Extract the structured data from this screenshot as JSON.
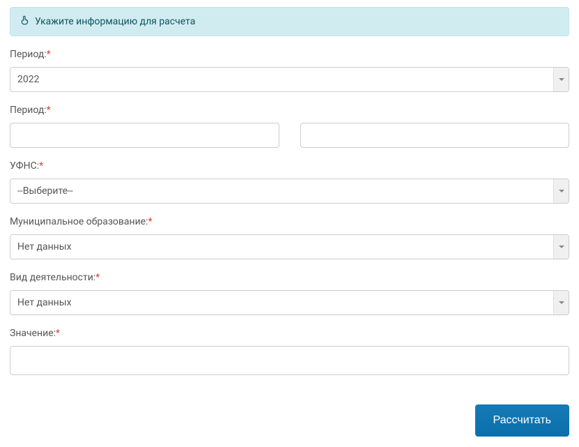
{
  "banner": {
    "text": "Укажите информацию для расчета"
  },
  "form": {
    "period_year": {
      "label": "Период:",
      "value": "2022"
    },
    "period_range": {
      "label": "Период:",
      "from": "",
      "to": ""
    },
    "ufns": {
      "label": "УФНС:",
      "value": "--Выберите--"
    },
    "municipality": {
      "label": "Муниципальное образование:",
      "value": "Нет данных"
    },
    "activity": {
      "label": "Вид деятельности:",
      "value": "Нет данных"
    },
    "znachenie": {
      "label": "Значение:",
      "value": ""
    }
  },
  "actions": {
    "calculate": "Рассчитать"
  },
  "symbols": {
    "required": "*"
  }
}
